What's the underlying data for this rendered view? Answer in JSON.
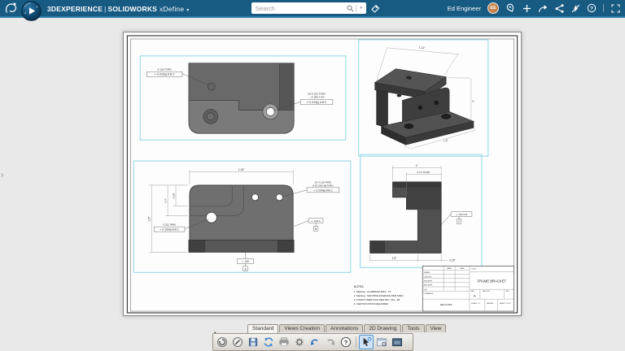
{
  "colors": {
    "header_bar": "#175a82",
    "header_accent": "#2f81ae",
    "selection_box": "#8fd6e8",
    "avatar": "#c4824d",
    "canvas": "#e9e9e9",
    "undo_blue": "#2f6fbe"
  },
  "header": {
    "brand": "3DEXPERIENCE",
    "separator": "|",
    "product": "SOLIDWORKS",
    "app": "xDefine",
    "menu_chevron": "▾",
    "search_placeholder": "Search",
    "search_chevron": "▾",
    "user_name": "Ed Engineer",
    "avatar_initials": "EE"
  },
  "left_panel": {
    "toggle": "›"
  },
  "toolbar": {
    "overflow_chevron": "▾",
    "tabs": [
      {
        "label": "Standard"
      },
      {
        "label": "Views Creation"
      },
      {
        "label": "Annotations"
      },
      {
        "label": "2D Drawing"
      },
      {
        "label": "Tools"
      },
      {
        "label": "View"
      }
    ]
  },
  "drawing": {
    "views": {
      "top": {
        "hole_callout": "∅.106 THRU",
        "hole_fcf": "⌖ ∅.010Ⓜ A B C",
        "cbore_callout_1": "2X ∅.201 THRU",
        "cbore_callout_2": "⌵ ∅.385 X 90°",
        "cbore_fcf": "⌖ ∅.014Ⓜ A B C"
      },
      "iso": {
        "dim_width": "1.12\"",
        "dim_height": "1\"",
        "dim_depth": "1.5\""
      },
      "front": {
        "dim_width": "1.15\"",
        "dim_height": "1.5\"",
        "dim_step": "0.4\"",
        "dim_flange": "0.20\"",
        "tap_callout_1": "2X ∅.136 THRU",
        "tap_callout_2": "8-32 UNC-2B THRU",
        "tap_fcf": "⌖ ∅.014Ⓜ A B C",
        "hole_callout": "∅.201 THRU",
        "hole_fcf": "⌖ ∅.010Ⓜ A B C",
        "perp_fcf": "⟂ .010 A",
        "perp_datum": "B",
        "flat_fcf": "▱ .010",
        "flat_datum": "A"
      },
      "side": {
        "dim_top": "1\"",
        "dim_flange": "0.73\" ±0.005",
        "dim_base": "1.5\"",
        "dim_wall": "0.25\"",
        "fcf": "⟂ .010 A B",
        "datum": "C"
      }
    },
    "notes": {
      "title": "NOTES:",
      "lines": [
        "1. Material : ALUMINUM 6061 - T6",
        "2. Marking : MACHINE ENGRAVE PER SPEC",
        "3. FINISH CHEM FILM PER 305 - 001 - #8",
        "4. CERTIFICATION REQUIRED"
      ]
    },
    "title_block": {
      "name_header": "NAME",
      "date_header": "DATE",
      "rows": [
        "DRAWN",
        "CHECKED",
        "ENG APPR.",
        "MFG APPR.",
        "Q.A.",
        "COMMENTS:"
      ],
      "material_note": "SEE NOTES",
      "title_label": "TITLE:",
      "title": "FRAME BRACKET",
      "size_label": "SIZE",
      "size": "A",
      "dwg_label": "DWG. NO.",
      "rev_label": "REV",
      "scale": "SCALE: 1:1",
      "weight": "WEIGHT:",
      "sheet": "SHEET 1 OF 1"
    }
  }
}
